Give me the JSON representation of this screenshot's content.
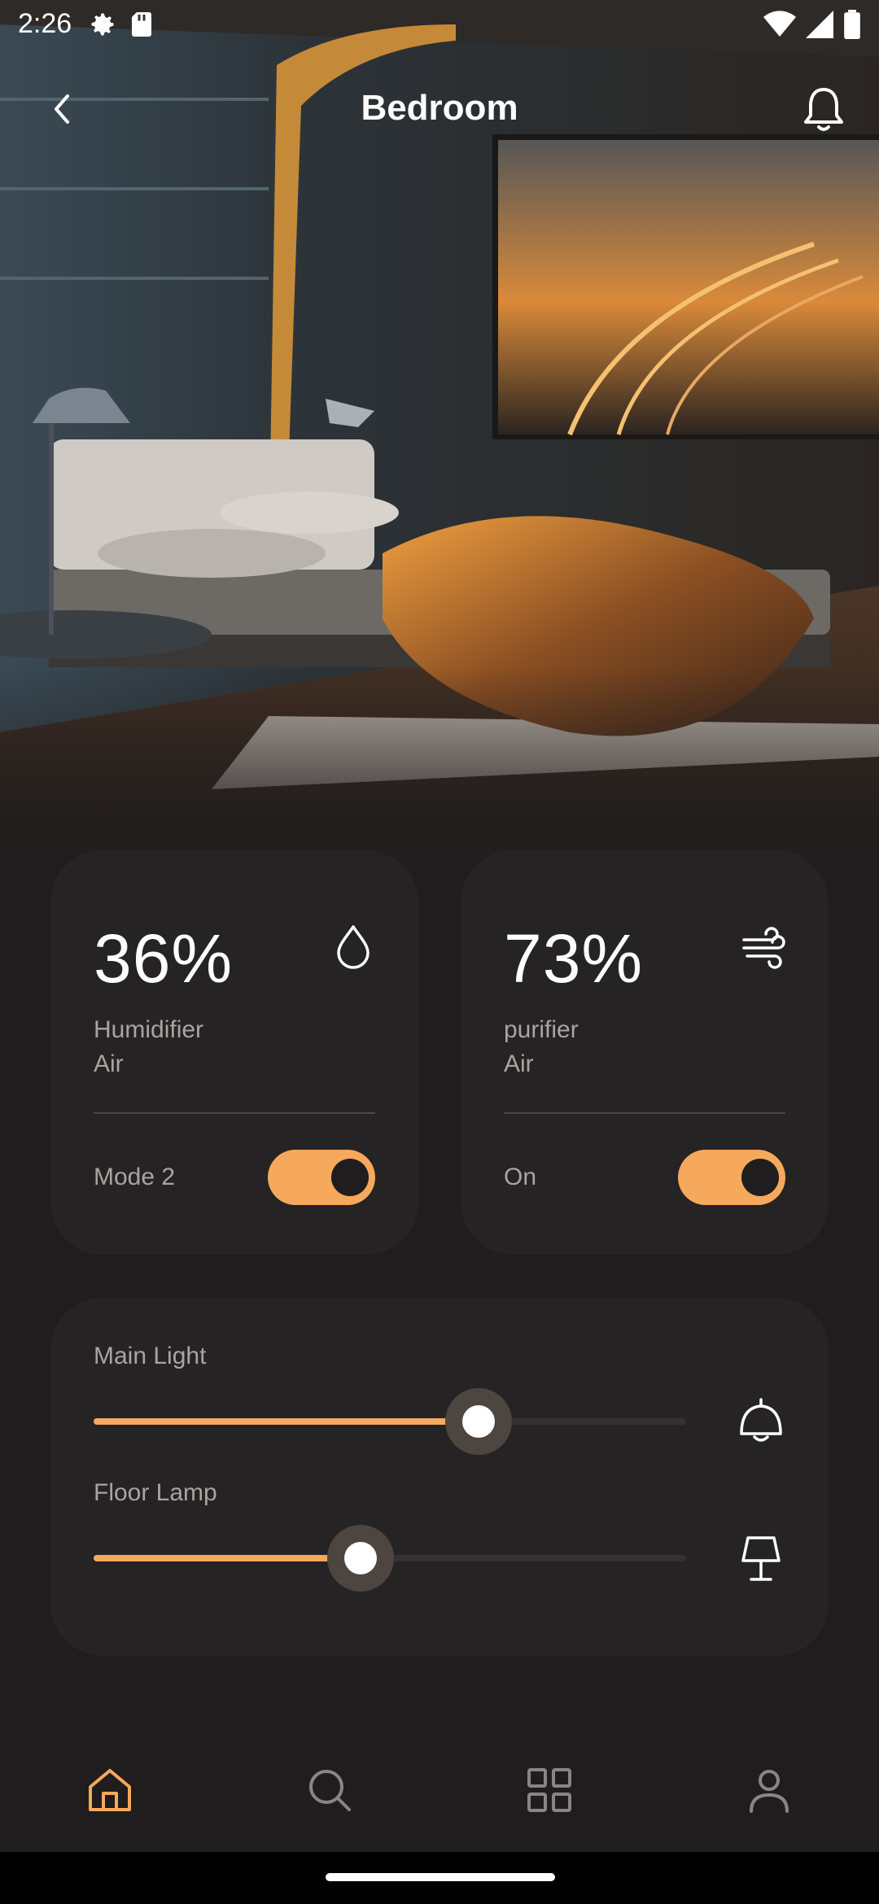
{
  "status_bar": {
    "time": "2:26"
  },
  "header": {
    "title": "Bedroom"
  },
  "devices": [
    {
      "value": "36%",
      "name_line1": "Humidifier",
      "name_line2": "Air",
      "mode": "Mode 2",
      "icon": "water-drop-icon",
      "toggle_on": true
    },
    {
      "value": "73%",
      "name_line1": "purifier",
      "name_line2": "Air",
      "mode": "On",
      "icon": "wind-icon",
      "toggle_on": true
    }
  ],
  "lights": [
    {
      "label": "Main Light",
      "level_percent": 65,
      "icon": "ceiling-lamp-icon"
    },
    {
      "label": "Floor Lamp",
      "level_percent": 45,
      "icon": "floor-lamp-icon"
    }
  ],
  "bottom_nav": [
    "home-icon",
    "search-icon",
    "grid-icon",
    "profile-icon"
  ],
  "colors": {
    "accent": "#f6a95c",
    "card": "#262324",
    "background": "#1f1d1e"
  }
}
